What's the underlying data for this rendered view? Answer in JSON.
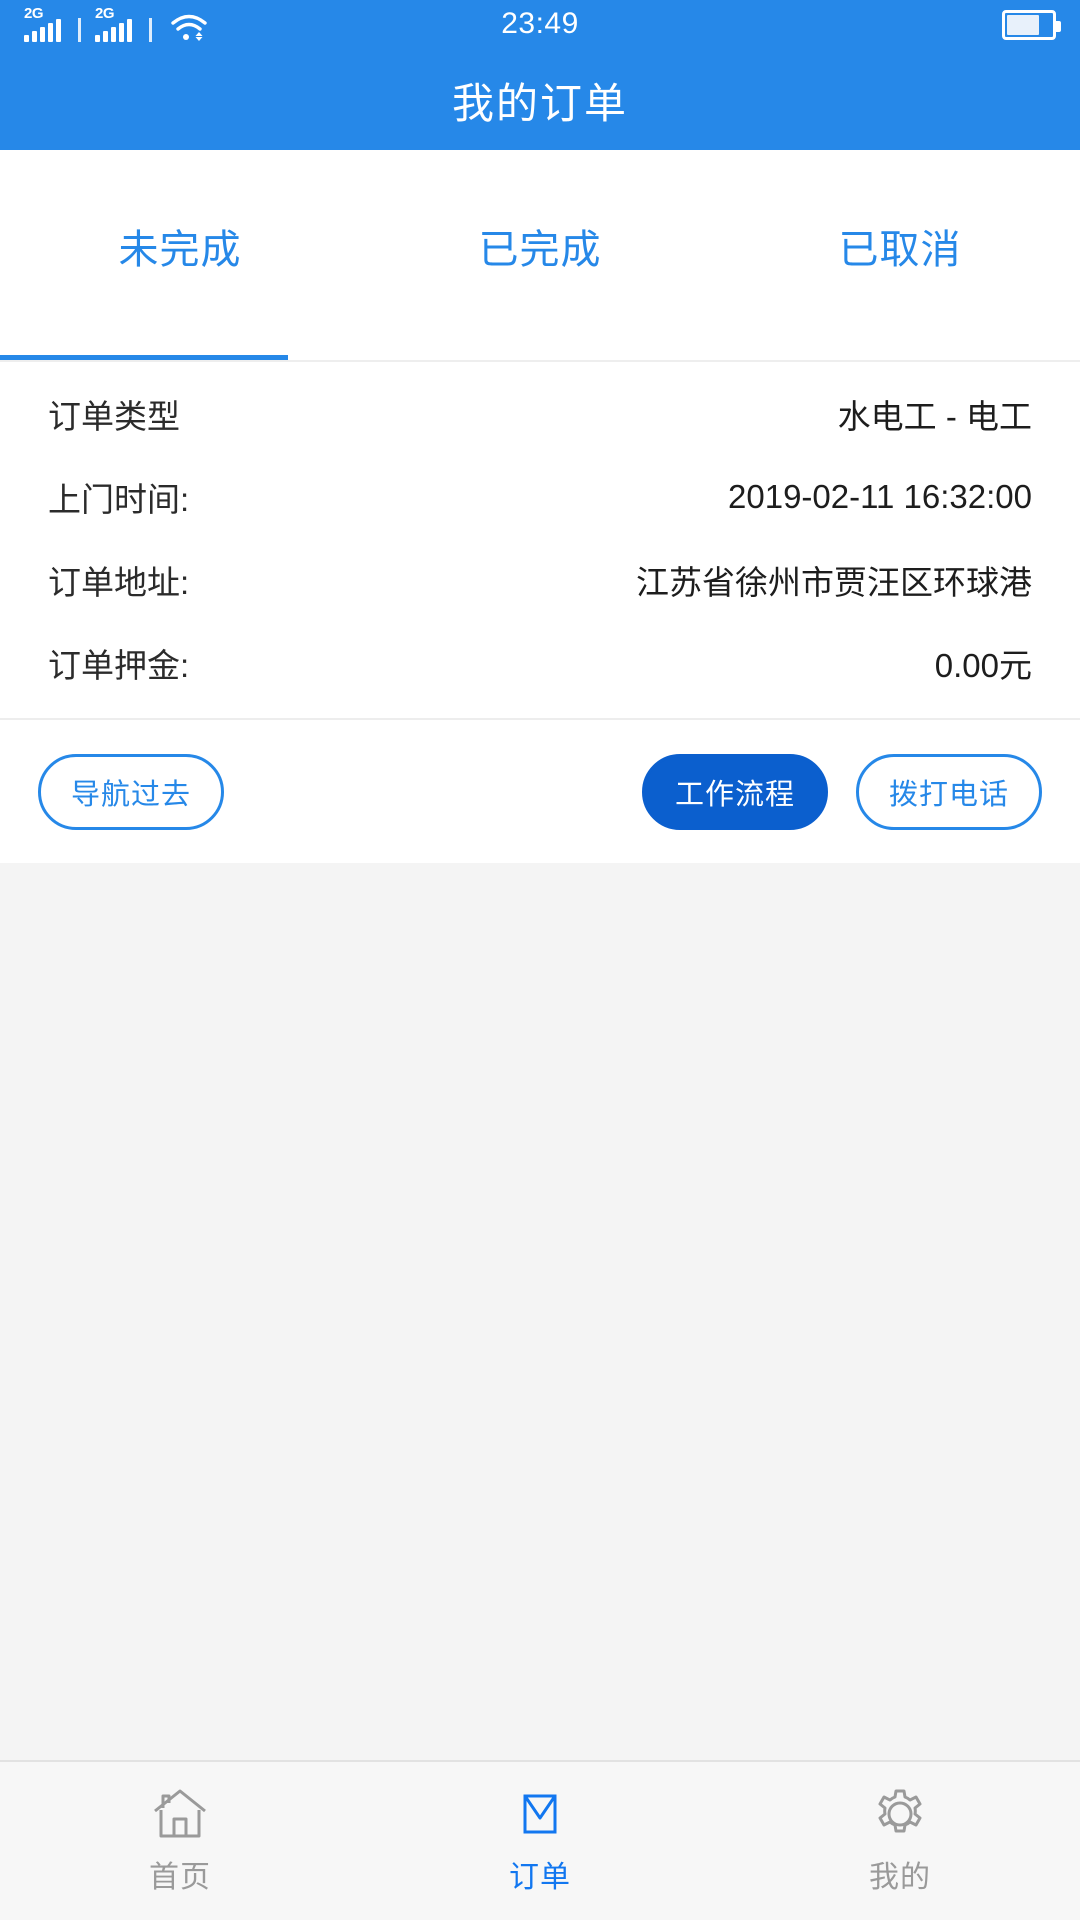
{
  "status_bar": {
    "network_label_1": "2G",
    "network_label_2": "2G",
    "time": "23:49",
    "icons": [
      "signal-2g-icon",
      "signal-2g-icon",
      "wifi-icon",
      "battery-icon"
    ]
  },
  "header": {
    "title": "我的订单"
  },
  "tabs": [
    {
      "label": "未完成",
      "active": true
    },
    {
      "label": "已完成",
      "active": false
    },
    {
      "label": "已取消",
      "active": false
    }
  ],
  "order": {
    "rows": [
      {
        "label": "订单类型",
        "value": "水电工 - 电工"
      },
      {
        "label": "上门时间:",
        "value": "2019-02-11 16:32:00"
      },
      {
        "label": "订单地址:",
        "value": "江苏省徐州市贾汪区环球港"
      },
      {
        "label": "订单押金:",
        "value": "0.00元"
      }
    ]
  },
  "actions": {
    "navigate": "导航过去",
    "workflow": "工作流程",
    "call": "拨打电话"
  },
  "bottom_nav": [
    {
      "label": "首页",
      "icon": "home-icon",
      "active": false
    },
    {
      "label": "订单",
      "icon": "envelope-icon",
      "active": true
    },
    {
      "label": "我的",
      "icon": "gear-icon",
      "active": false
    }
  ],
  "colors": {
    "brand_blue": "#2688e8",
    "filled_button_blue": "#0b5fce",
    "active_nav_blue": "#1277f0",
    "inactive_gray": "#9a9a9a",
    "page_background": "#f4f4f4"
  }
}
